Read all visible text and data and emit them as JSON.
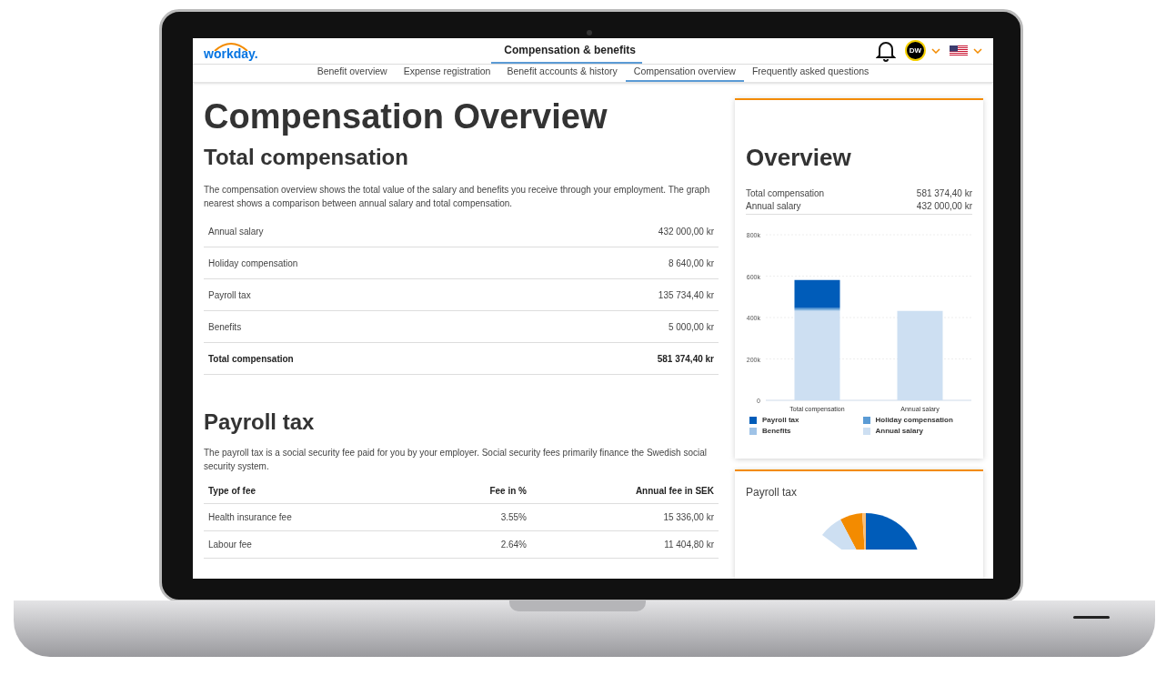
{
  "header": {
    "logo": "workday.",
    "main_tabs": [
      {
        "label": "Compensation & benefits",
        "selected": true
      }
    ],
    "avatar": "DW"
  },
  "subnav": [
    {
      "label": "Benefit overview",
      "selected": false
    },
    {
      "label": "Expense registration",
      "selected": false
    },
    {
      "label": "Benefit accounts & history",
      "selected": false
    },
    {
      "label": "Compensation overview",
      "selected": true
    },
    {
      "label": "Frequently asked questions",
      "selected": false
    }
  ],
  "page_title": "Compensation Overview",
  "total": {
    "heading": "Total compensation",
    "description": "The compensation overview shows the total value of the salary and benefits you receive through your employment. The graph nearest shows a comparison between annual salary and total compensation.",
    "rows": [
      {
        "label": "Annual salary",
        "value": "432 000,00 kr",
        "total": false
      },
      {
        "label": "Holiday compensation",
        "value": "8 640,00 kr",
        "total": false
      },
      {
        "label": "Payroll tax",
        "value": "135 734,40 kr",
        "total": false
      },
      {
        "label": "Benefits",
        "value": "5 000,00 kr",
        "total": false
      },
      {
        "label": "Total compensation",
        "value": "581 374,40 kr",
        "total": true
      }
    ]
  },
  "payroll": {
    "heading": "Payroll tax",
    "description": "The payroll tax is a social security fee paid for you by your employer. Social security fees primarily finance the Swedish social security system.",
    "columns": [
      "Type of fee",
      "Fee in %",
      "Annual fee in SEK"
    ],
    "rows": [
      [
        "Health insurance fee",
        "3.55%",
        "15 336,00 kr"
      ],
      [
        "Labour fee",
        "2.64%",
        "11 404,80 kr"
      ]
    ]
  },
  "overview_card": {
    "title": "Overview",
    "summary": [
      {
        "label": "Total compensation",
        "value": "581 374,40 kr"
      },
      {
        "label": "Annual salary",
        "value": "432 000,00 kr"
      }
    ],
    "chart_data": {
      "type": "bar",
      "stacked": true,
      "categories": [
        "Total compensation",
        "Annual salary"
      ],
      "series": [
        {
          "name": "Annual salary",
          "color": "#cddff2",
          "values": [
            432000,
            432000
          ]
        },
        {
          "name": "Benefits",
          "color": "#9fc3e7",
          "values": [
            5000,
            null
          ]
        },
        {
          "name": "Holiday compensation",
          "color": "#5b9bd5",
          "values": [
            8640,
            null
          ]
        },
        {
          "name": "Payroll tax",
          "color": "#005cb9",
          "values": [
            135734.4,
            null
          ]
        }
      ],
      "grid": true,
      "legend": true,
      "ylim": [
        0,
        800000
      ],
      "yticks": [
        {
          "value": 0,
          "label": "0"
        },
        {
          "value": 200000,
          "label": "200k"
        },
        {
          "value": 400000,
          "label": "400k"
        },
        {
          "value": 600000,
          "label": "600k"
        },
        {
          "value": 800000,
          "label": "800k"
        }
      ]
    }
  },
  "payroll_card": {
    "title": "Payroll tax"
  }
}
